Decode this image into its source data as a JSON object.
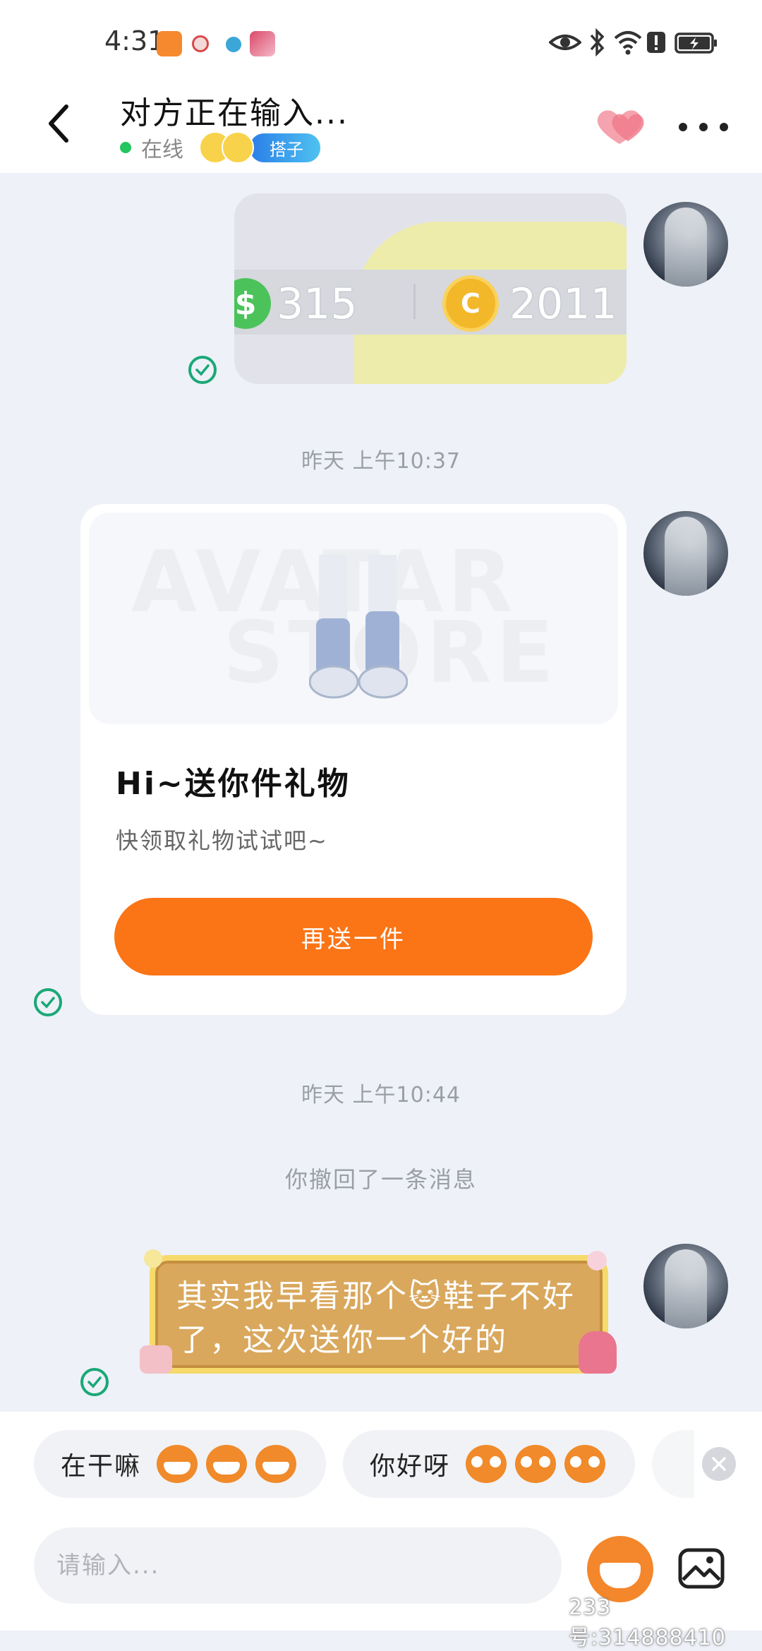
{
  "status_bar": {
    "time": "4:31"
  },
  "header": {
    "title": "对方正在输入...",
    "online_status": "在线",
    "tag": "搭子"
  },
  "messages": {
    "image_msg": {
      "coin_green_value": "315",
      "coin_gold_value": "2011",
      "coin_green_symbol": "$",
      "coin_gold_symbol": "C"
    },
    "timestamp_1": "昨天 上午10:37",
    "gift_card": {
      "watermark_line1": "AVATAR",
      "watermark_line2": "STORE",
      "title": "Hi~送你件礼物",
      "subtitle": "快领取礼物试试吧~",
      "button_label": "再送一件"
    },
    "timestamp_2": "昨天 上午10:44",
    "recall_note": "你撤回了一条消息",
    "sticker_msg": {
      "text": "其实我早看那个🐱鞋子不好了，这次送你一个好的"
    }
  },
  "quick_replies": [
    {
      "label": "在干嘛"
    },
    {
      "label": "你好呀"
    }
  ],
  "input": {
    "placeholder": "请输入..."
  },
  "watermark": "233号:314888410",
  "colors": {
    "accent_orange": "#fb7416",
    "check_green": "#1aa877",
    "online_green": "#22c55e",
    "tag_blue": "#2a7ee8"
  }
}
